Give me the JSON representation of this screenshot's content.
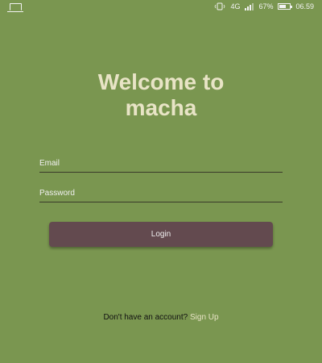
{
  "status_bar": {
    "network": "4G",
    "battery_percent": "67%",
    "battery_level": 0.67,
    "time": "06.59",
    "icons": [
      "laptop-icon",
      "vibrate-icon",
      "signal-icon",
      "battery-icon"
    ]
  },
  "welcome": {
    "line1": "Welcome to",
    "line2": "macha"
  },
  "form": {
    "email_placeholder": "Email",
    "password_placeholder": "Password",
    "login_label": "Login"
  },
  "signup": {
    "question": "Don't have an account?",
    "link": "Sign Up"
  },
  "colors": {
    "background": "#7a9650",
    "button": "#634a4f",
    "title": "#e8e4c6"
  }
}
